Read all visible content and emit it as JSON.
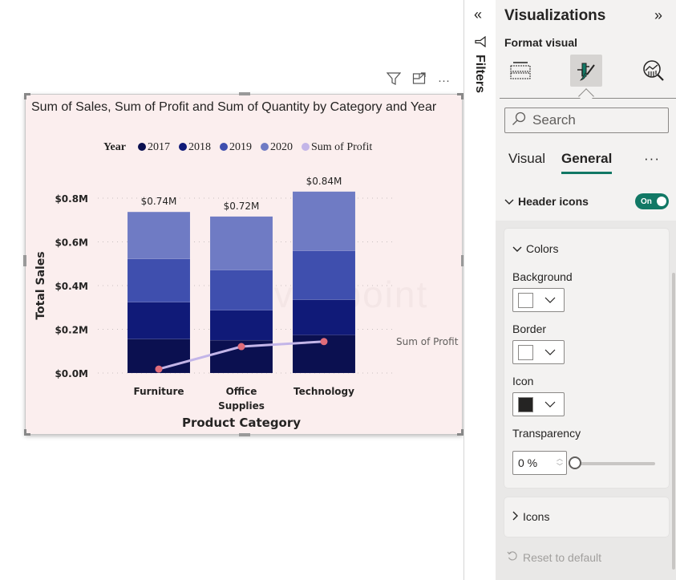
{
  "visual_header": {
    "filter_icon": "filter-funnel-icon",
    "focus_icon": "focus-mode-icon",
    "more_icon": "more-options-icon",
    "more_label": "···"
  },
  "chart_data": {
    "type": "bar",
    "subtype": "stacked column with line",
    "title": "Sum of Sales, Sum of Profit and Sum of Quantity by Category and Year",
    "xlabel": "Product Category",
    "ylabel": "Total Sales",
    "categories": [
      "Furniture",
      "Office Supplies",
      "Technology"
    ],
    "category_labels": [
      [
        "Furniture"
      ],
      [
        "Office",
        "Supplies"
      ],
      [
        "Technology"
      ]
    ],
    "legend_title": "Year",
    "legend_position": "top-center",
    "series": [
      {
        "name": "2017",
        "color": "#0b1050",
        "values": [
          0.155,
          0.15,
          0.174
        ]
      },
      {
        "name": "2018",
        "color": "#101a78",
        "values": [
          0.169,
          0.137,
          0.161
        ]
      },
      {
        "name": "2019",
        "color": "#3f4fae",
        "values": [
          0.198,
          0.184,
          0.224
        ]
      },
      {
        "name": "2020",
        "color": "#6f7bc4",
        "values": [
          0.215,
          0.245,
          0.271
        ]
      }
    ],
    "totals_labels": [
      "$0.74M",
      "$0.72M",
      "$0.84M"
    ],
    "line_series": {
      "name": "Sum of Profit",
      "line_color": "#c3b5e8",
      "marker_color": "#e06c7a",
      "values_on_sales_axis": [
        0.018,
        0.121,
        0.144
      ],
      "end_label": "Sum of Profit"
    },
    "yticks": [
      "$0.0M",
      "$0.2M",
      "$0.4M",
      "$0.6M",
      "$0.8M"
    ],
    "ytick_values": [
      0,
      0.2,
      0.4,
      0.6,
      0.8
    ],
    "ylim": [
      0,
      0.8
    ],
    "grid": "horizontal dotted"
  },
  "watermark": "javaTpoint",
  "filters_strip": {
    "collapse_label": "«",
    "label": "Filters"
  },
  "viz_pane": {
    "title": "Visualizations",
    "expand_label": "»",
    "subtitle": "Format visual",
    "icons": [
      "build-visual-icon",
      "format-visual-icon",
      "analytics-icon"
    ],
    "search": {
      "placeholder": "Search",
      "value": ""
    },
    "tabs": [
      {
        "label": "Visual",
        "active": false
      },
      {
        "label": "General",
        "active": true
      }
    ],
    "more_label": "···",
    "section": {
      "label": "Header icons",
      "toggle_label": "On",
      "toggle_on": true
    },
    "colors_card": {
      "title": "Colors",
      "background_label": "Background",
      "background_color": "#ffffff",
      "border_label": "Border",
      "border_color": "#ffffff",
      "icon_label": "Icon",
      "icon_color": "#252423",
      "transparency_label": "Transparency",
      "transparency_value": "0 %",
      "transparency_percent": 0
    },
    "icons_card": {
      "title": "Icons"
    },
    "reset_label": "Reset to default"
  },
  "colors": {
    "accent": "#117865",
    "visual_bg": "#fbeeee",
    "pane_bg": "#f3f2f1"
  }
}
